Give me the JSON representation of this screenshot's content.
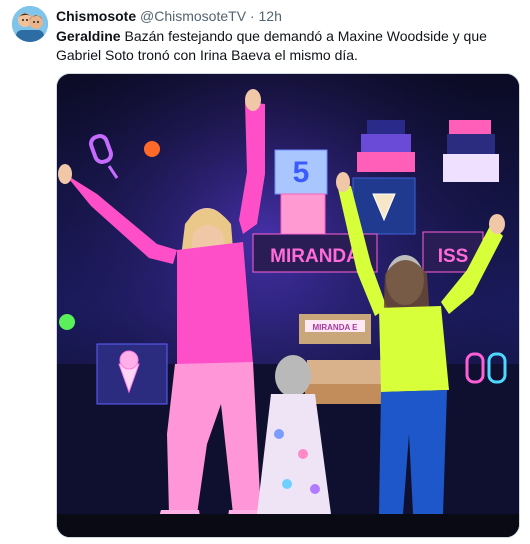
{
  "tweet": {
    "display_name": "Chismosote",
    "handle": "@ChismosoteTV",
    "separator": "·",
    "time": "12h",
    "text_bold": "Geraldine",
    "text_rest": " Bazán festejando que demandó a Maxine Woodside y que Gabriel Soto tronó con Irina Baeva el mismo día.",
    "media": {
      "sign_text": "MIRANDA",
      "sign_text_right": "ISS",
      "cake_number": "5",
      "cake_banner": "MIRANDA E"
    }
  },
  "colors": {
    "text_primary": "#0f1419",
    "text_secondary": "#536471",
    "border": "#cfd9de",
    "neon_pink": "#ff4fc8",
    "neon_yellow": "#d7ff3a",
    "stage_blue": "#1a1b5e"
  }
}
